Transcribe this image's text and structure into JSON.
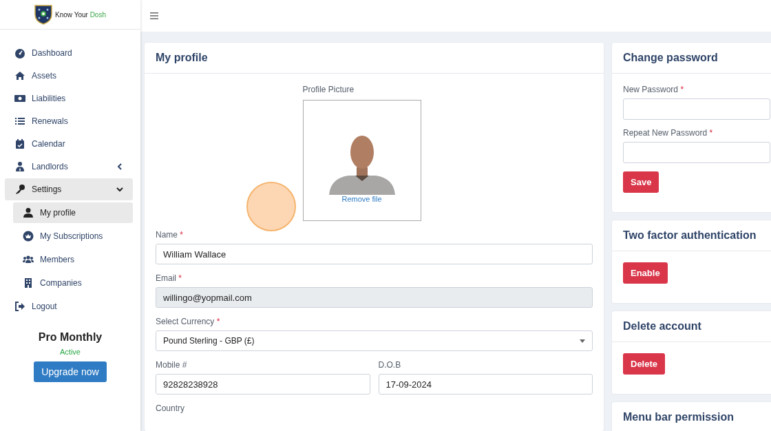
{
  "logo": {
    "text": "Know Your",
    "accent": "Dosh"
  },
  "sidebar": {
    "items": [
      {
        "label": "Dashboard",
        "kind": "gauge",
        "selected": false
      },
      {
        "label": "Assets",
        "kind": "home",
        "selected": false
      },
      {
        "label": "Liabilities",
        "kind": "money",
        "selected": false
      },
      {
        "label": "Renewals",
        "kind": "list",
        "selected": false
      },
      {
        "label": "Calendar",
        "kind": "calendar",
        "selected": false
      },
      {
        "label": "Landlords",
        "kind": "landlord",
        "selected": false,
        "expanded": false
      },
      {
        "label": "Settings",
        "kind": "key",
        "selected": true,
        "expanded": true,
        "children": [
          {
            "label": "My profile",
            "kind": "user",
            "selected": true
          },
          {
            "label": "My Subscriptions",
            "kind": "crown",
            "selected": false
          },
          {
            "label": "Members",
            "kind": "users",
            "selected": false
          },
          {
            "label": "Companies",
            "kind": "building",
            "selected": false
          }
        ]
      },
      {
        "label": "Logout",
        "kind": "logout",
        "selected": false
      }
    ],
    "plan": {
      "name": "Pro Monthly",
      "status": "Active",
      "button": "Upgrade now"
    }
  },
  "profile": {
    "title": "My profile",
    "picture_label": "Profile Picture",
    "remove_link": "Remove file",
    "fields": [
      {
        "label": "Name",
        "required_mark": "*",
        "value": "William Wallace",
        "kind": "text"
      },
      {
        "label": "Email",
        "required_mark": "*",
        "value": "willingo@yopmail.com",
        "kind": "text",
        "disabled": true
      },
      {
        "label": "Select Currency",
        "required_mark": "*",
        "value": "Pound Sterling - GBP (£)",
        "kind": "select"
      }
    ],
    "pair": [
      {
        "label": "Mobile #",
        "value": "92828238928",
        "kind": "text"
      },
      {
        "label": "D.O.B",
        "value": "17-09-2024",
        "kind": "text"
      }
    ],
    "last_label": "Country"
  },
  "cards": [
    {
      "title": "Change password",
      "fields": [
        {
          "label": "New Password",
          "required_mark": "*"
        },
        {
          "label": "Repeat New Password",
          "required_mark": "*"
        }
      ],
      "button": "Save"
    },
    {
      "title": "Two factor authentication",
      "button": "Enable"
    },
    {
      "title": "Delete account",
      "button": "Delete"
    },
    {
      "title": "Menu bar permission"
    }
  ]
}
